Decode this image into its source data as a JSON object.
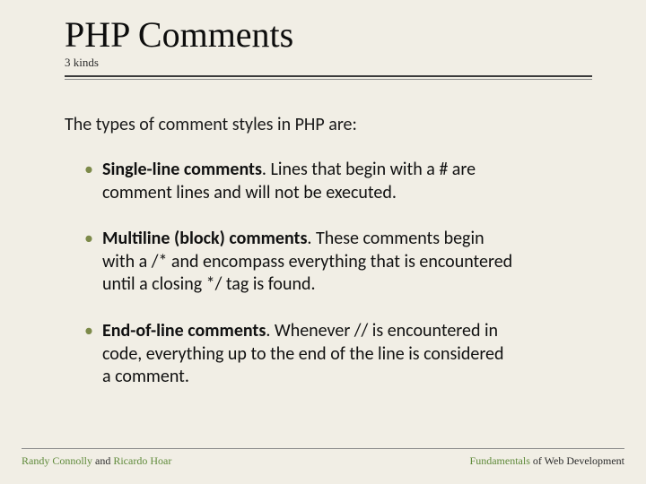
{
  "title": "PHP Comments",
  "subtitle": "3 kinds",
  "intro": "The types of comment styles in PHP are:",
  "bullets": [
    {
      "lead": "Single-line comments",
      "rest": ". Lines that begin with a # are comment lines and will not be executed."
    },
    {
      "lead": "Multiline (block) comments",
      "rest": ". These comments begin with a /* and encompass everything that is encountered until a closing */ tag is found."
    },
    {
      "lead": "End-of-line comments",
      "rest": ". Whenever // is encountered in code, everything up to the end of the line is considered a comment."
    }
  ],
  "footer": {
    "left": {
      "a1": "Randy Connolly",
      "mid": " and ",
      "a2": "Ricardo Hoar"
    },
    "right": {
      "a1": "Fundamentals",
      "mid": " of Web Development"
    }
  }
}
